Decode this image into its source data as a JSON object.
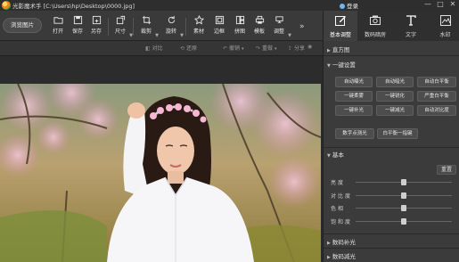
{
  "titlebar": {
    "app_title": "光影魔术手 [C:\\Users\\hp\\Desktop\\0000.jpg]",
    "login_label": "登录",
    "minimize_glyph": "—",
    "maximize_glyph": "□",
    "close_glyph": "✕"
  },
  "toolbar": {
    "open_image_label": "浏览图片",
    "tools": [
      {
        "label": "打开"
      },
      {
        "label": "保存"
      },
      {
        "label": "另存"
      },
      {
        "label": "尺寸"
      },
      {
        "label": "裁剪"
      },
      {
        "label": "旋转"
      },
      {
        "label": "素材"
      },
      {
        "label": "边框"
      },
      {
        "label": "拼图"
      },
      {
        "label": "模板"
      },
      {
        "label": "调整"
      }
    ]
  },
  "subbar": {
    "compare_label": "对比",
    "restore_label": "还原",
    "undo_label": "撤销",
    "redo_label": "重做",
    "share_label": "分享",
    "snapshot_label": "快照"
  },
  "panel": {
    "tabs": [
      {
        "label": "基本调整",
        "active": true
      },
      {
        "label": "数码暗房",
        "active": false
      },
      {
        "label": "文字",
        "active": false
      },
      {
        "label": "水印",
        "active": false
      }
    ],
    "histogram_label": "直方图",
    "one_click_label": "一键设置",
    "one_click_buttons": [
      "自动曝光",
      "自动暗光",
      "自动白平衡",
      "一键柔雾",
      "一键锐化",
      "严重白平衡",
      "一键补光",
      "一键减光",
      "自动对比度"
    ],
    "extra_buttons": [
      "数字点测光",
      "白平衡一指键"
    ],
    "basic_label": "基本",
    "reset_label": "重置",
    "sliders": [
      {
        "label": "亮度",
        "value": 0.5
      },
      {
        "label": "对比度",
        "value": 0.5
      },
      {
        "label": "色相",
        "value": 0.5
      },
      {
        "label": "饱和度",
        "value": 0.5
      }
    ],
    "fill_light_label": "数码补光",
    "reduce_light_label": "数码减光"
  }
}
